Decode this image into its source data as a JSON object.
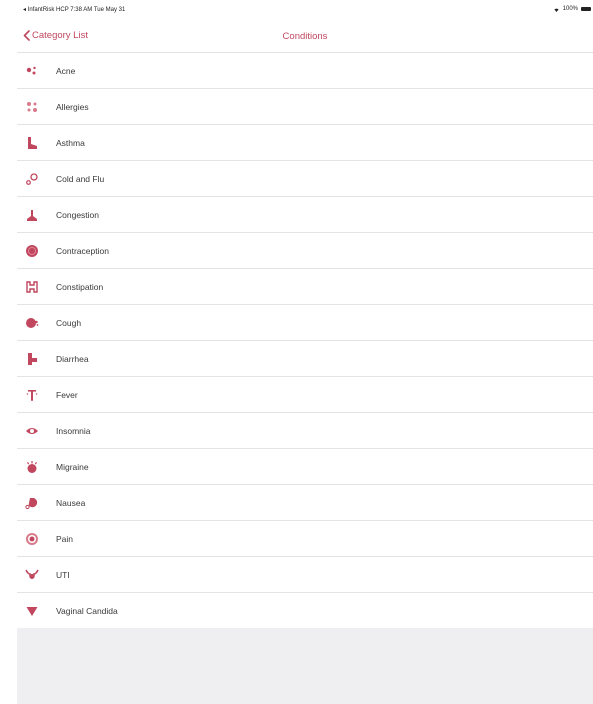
{
  "status_bar": {
    "left_text": "◂ InfantRisk HCP  7:38 AM  Tue May 31",
    "battery_text": "100%"
  },
  "nav": {
    "back_label": "Category List",
    "title": "Conditions"
  },
  "accent_color": "#c0475e",
  "conditions": [
    {
      "label": "Acne",
      "icon": "acne-icon"
    },
    {
      "label": "Allergies",
      "icon": "allergies-icon"
    },
    {
      "label": "Asthma",
      "icon": "asthma-icon"
    },
    {
      "label": "Cold and Flu",
      "icon": "cold-flu-icon"
    },
    {
      "label": "Congestion",
      "icon": "congestion-icon"
    },
    {
      "label": "Contraception",
      "icon": "contraception-icon"
    },
    {
      "label": "Constipation",
      "icon": "constipation-icon"
    },
    {
      "label": "Cough",
      "icon": "cough-icon"
    },
    {
      "label": "Diarrhea",
      "icon": "diarrhea-icon"
    },
    {
      "label": "Fever",
      "icon": "fever-icon"
    },
    {
      "label": "Insomnia",
      "icon": "insomnia-icon"
    },
    {
      "label": "Migraine",
      "icon": "migraine-icon"
    },
    {
      "label": "Nausea",
      "icon": "nausea-icon"
    },
    {
      "label": "Pain",
      "icon": "pain-icon"
    },
    {
      "label": "UTI",
      "icon": "uti-icon"
    },
    {
      "label": "Vaginal Candida",
      "icon": "vaginal-candida-icon"
    }
  ]
}
